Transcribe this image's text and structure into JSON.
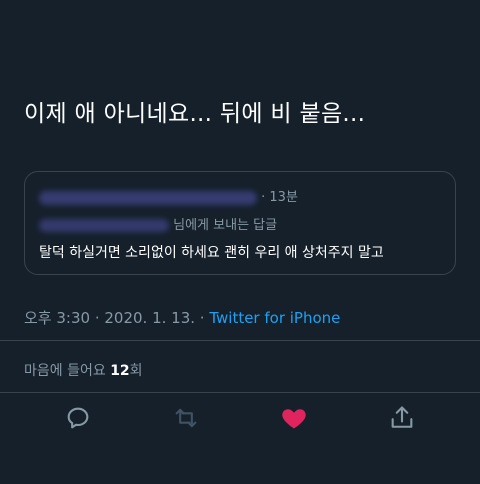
{
  "tweet": {
    "text": "이제 애 아니네요... 뒤에 비 붙음..."
  },
  "quoted_tweet": {
    "time_suffix": "· 13분",
    "reply_to_suffix": "님에게 보내는 답글",
    "body": "탈덕 하실거면 소리없이 하세요 괜히 우리 애 상처주지 말고"
  },
  "meta": {
    "timestamp": "오후 3:30 · 2020. 1. 13. ·",
    "source": "Twitter for iPhone"
  },
  "likes": {
    "label_prefix": "마음에 들어요",
    "count": "12",
    "label_suffix": "회"
  },
  "colors": {
    "background": "#15202b",
    "secondary_text": "#8899a6",
    "link": "#1da1f2",
    "like_active": "#e0245e",
    "border": "#38444d"
  },
  "actions": {
    "reply_icon": "reply-icon",
    "retweet_icon": "retweet-icon",
    "like_icon": "heart-icon",
    "share_icon": "share-icon",
    "liked": true
  }
}
